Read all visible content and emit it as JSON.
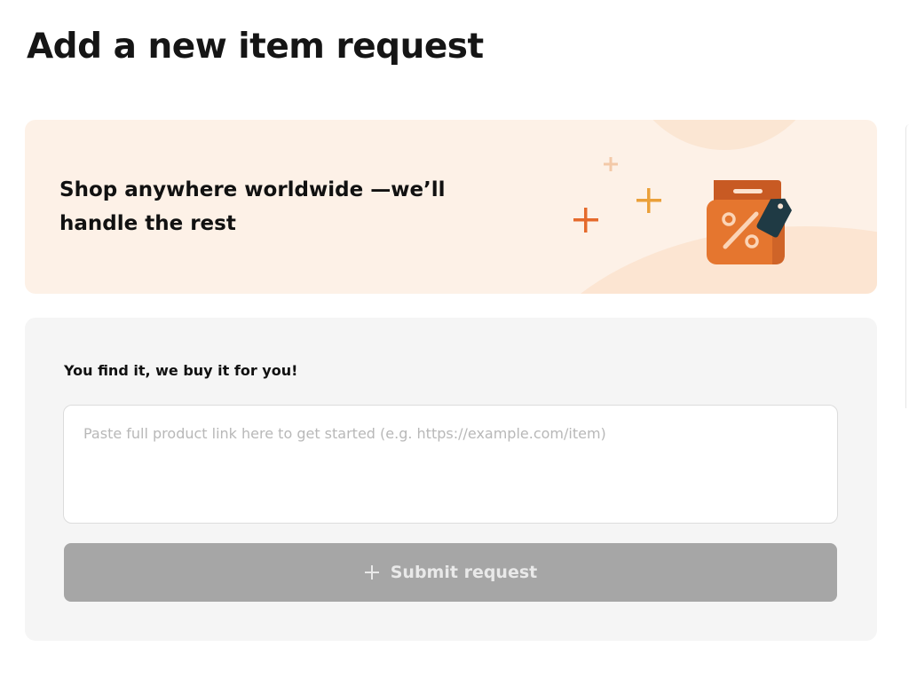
{
  "page": {
    "title": "Add a new item request"
  },
  "banner": {
    "text": "Shop anywhere worldwide —we’ll handle the rest",
    "illustration_icon": "shopping-bag-discount-icon",
    "colors": {
      "background": "#fdf1e7",
      "bag": "#e5762f",
      "tag": "#1f3a44"
    }
  },
  "form": {
    "label": "You find it, we buy it for you!",
    "link_input": {
      "value": "",
      "placeholder": "Paste full product link here to get started (e.g. https://example.com/item)"
    },
    "submit": {
      "label": "Submit request",
      "icon": "plus-icon",
      "state": "disabled",
      "color": "#a6a6a6"
    }
  }
}
